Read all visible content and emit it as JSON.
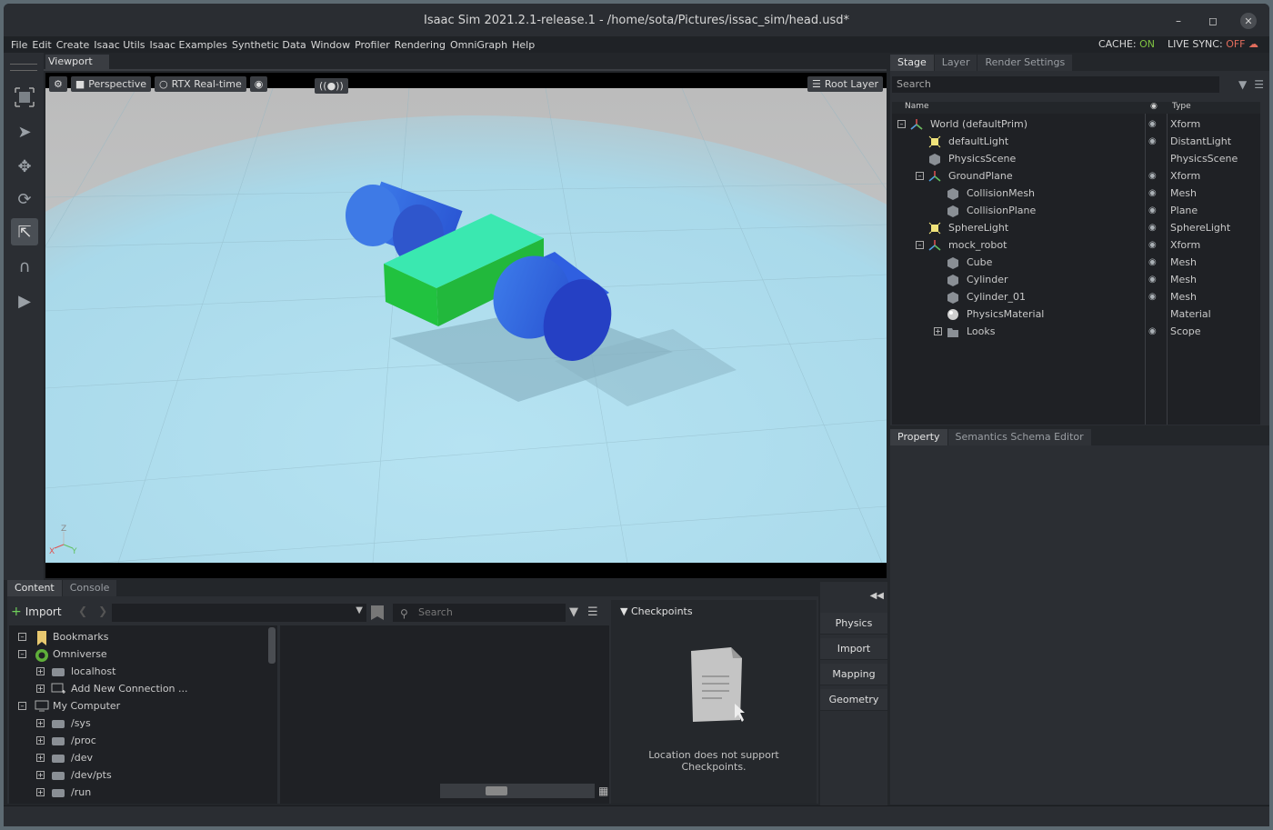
{
  "window": {
    "title": "Isaac Sim 2021.2.1-release.1 - /home/sota/Pictures/issac_sim/head.usd*",
    "minimize_icon": "minimize-icon",
    "maximize_icon": "maximize-icon",
    "close_icon": "close-icon"
  },
  "menu": {
    "items": [
      "File",
      "Edit",
      "Create",
      "Isaac Utils",
      "Isaac Examples",
      "Synthetic Data",
      "Window",
      "Profiler",
      "Rendering",
      "OmniGraph",
      "Help"
    ],
    "cache_label": "CACHE:",
    "cache_value": "ON",
    "livesync_label": "LIVE SYNC:",
    "livesync_value": "OFF"
  },
  "viewport": {
    "tab": "Viewport",
    "camera": "Perspective",
    "renderer": "RTX Real-time",
    "root_layer": "Root Layer",
    "axis": {
      "z": "Z",
      "x": "X",
      "y": "Y"
    }
  },
  "stage": {
    "tabs": [
      "Stage",
      "Layer",
      "Render Settings"
    ],
    "search_placeholder": "Search",
    "col_name": "Name",
    "col_type": "Type",
    "rows": [
      {
        "name": "World (defaultPrim)",
        "type": "Xform"
      },
      {
        "name": "defaultLight",
        "type": "DistantLight"
      },
      {
        "name": "PhysicsScene",
        "type": "PhysicsScene"
      },
      {
        "name": "GroundPlane",
        "type": "Xform"
      },
      {
        "name": "CollisionMesh",
        "type": "Mesh"
      },
      {
        "name": "CollisionPlane",
        "type": "Plane"
      },
      {
        "name": "SphereLight",
        "type": "SphereLight"
      },
      {
        "name": "mock_robot",
        "type": "Xform"
      },
      {
        "name": "Cube",
        "type": "Mesh"
      },
      {
        "name": "Cylinder",
        "type": "Mesh"
      },
      {
        "name": "Cylinder_01",
        "type": "Mesh"
      },
      {
        "name": "PhysicsMaterial",
        "type": "Material"
      },
      {
        "name": "Looks",
        "type": "Scope"
      }
    ]
  },
  "property": {
    "tabs": [
      "Property",
      "Semantics Schema Editor"
    ]
  },
  "content": {
    "tabs": [
      "Content",
      "Console"
    ],
    "import_label": "Import",
    "search_placeholder": "Search",
    "tree": [
      {
        "name": "Bookmarks"
      },
      {
        "name": "Omniverse"
      },
      {
        "name": "localhost"
      },
      {
        "name": "Add New Connection ..."
      },
      {
        "name": "My Computer"
      },
      {
        "name": "/sys"
      },
      {
        "name": "/proc"
      },
      {
        "name": "/dev"
      },
      {
        "name": "/dev/pts"
      },
      {
        "name": "/run"
      }
    ],
    "checkpoints_title": "Checkpoints",
    "checkpoints_msg_1": "Location does not support",
    "checkpoints_msg_2": "Checkpoints."
  },
  "side_panel": {
    "buttons": [
      "Physics",
      "Import",
      "Mapping",
      "Geometry"
    ]
  },
  "colors": {
    "accent_on": "#7fc241",
    "accent_off": "#e06c5c",
    "cube": "#2bd159",
    "cylinder": "#2f5fe0",
    "ground": "#a8d8ea"
  }
}
